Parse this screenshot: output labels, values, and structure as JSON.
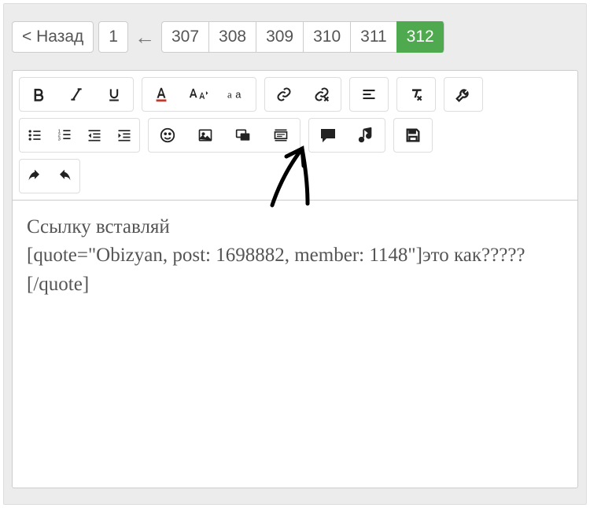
{
  "pager": {
    "back_label": "< Назад",
    "first_page": "1",
    "ellipsis": "←",
    "pages": [
      "307",
      "308",
      "309",
      "310",
      "311",
      "312"
    ],
    "current": "312"
  },
  "editor_content": {
    "line1": "Ссылку вставляй",
    "line2": "[quote=\"Obizyan, post: 1698882, member: 1148\"]это как?????[/quote]"
  },
  "toolbar_icons": {
    "bold": "bold-icon",
    "italic": "italic-icon",
    "underline": "underline-icon",
    "text_color": "text-color-icon",
    "font_size": "font-size-icon",
    "font_family": "font-family-icon",
    "insert_link": "link-icon",
    "remove_link": "unlink-icon",
    "align": "align-icon",
    "remove_format": "remove-format-icon",
    "settings": "wrench-icon",
    "ul": "unordered-list-icon",
    "ol": "ordered-list-icon",
    "outdent": "outdent-icon",
    "indent": "indent-icon",
    "smiley": "smiley-icon",
    "image": "image-icon",
    "media": "media-icon",
    "quote_block": "quote-block-icon",
    "speech": "speech-bubble-icon",
    "music": "music-icon",
    "save": "save-icon",
    "undo": "undo-icon",
    "redo": "redo-icon"
  }
}
